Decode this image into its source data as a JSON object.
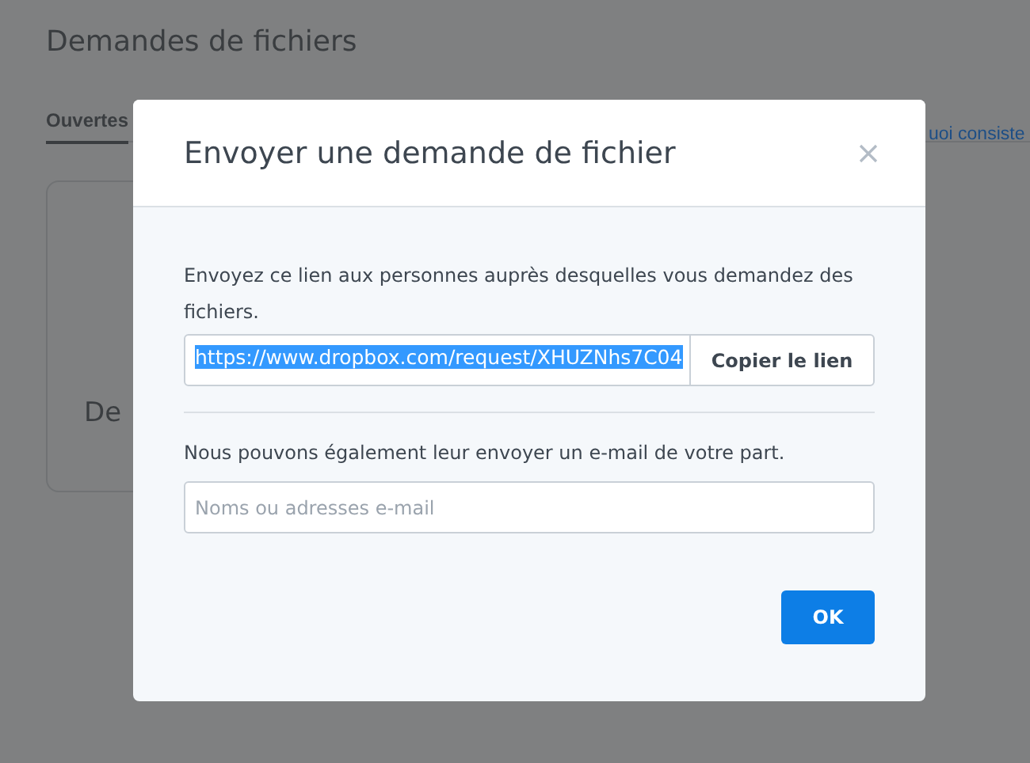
{
  "page": {
    "title": "Demandes de fichiers",
    "tabs": [
      {
        "label": "Ouvertes",
        "selected": true
      }
    ],
    "help_link": "uoi consiste",
    "card_title": "De"
  },
  "dialog": {
    "title": "Envoyer une demande de fichier",
    "link_instructions": "Envoyez ce lien aux personnes auprès desquelles vous demandez des fichiers.",
    "link_field": {
      "value": "https://www.dropbox.com/request/XHUZNhs7C04",
      "selected": true
    },
    "copy_button": "Copier le lien",
    "email_instructions": "Nous pouvons également leur envoyer un e-mail de votre part.",
    "email_field": {
      "placeholder": "Noms ou adresses e-mail"
    },
    "buttons": [
      "OK"
    ]
  }
}
